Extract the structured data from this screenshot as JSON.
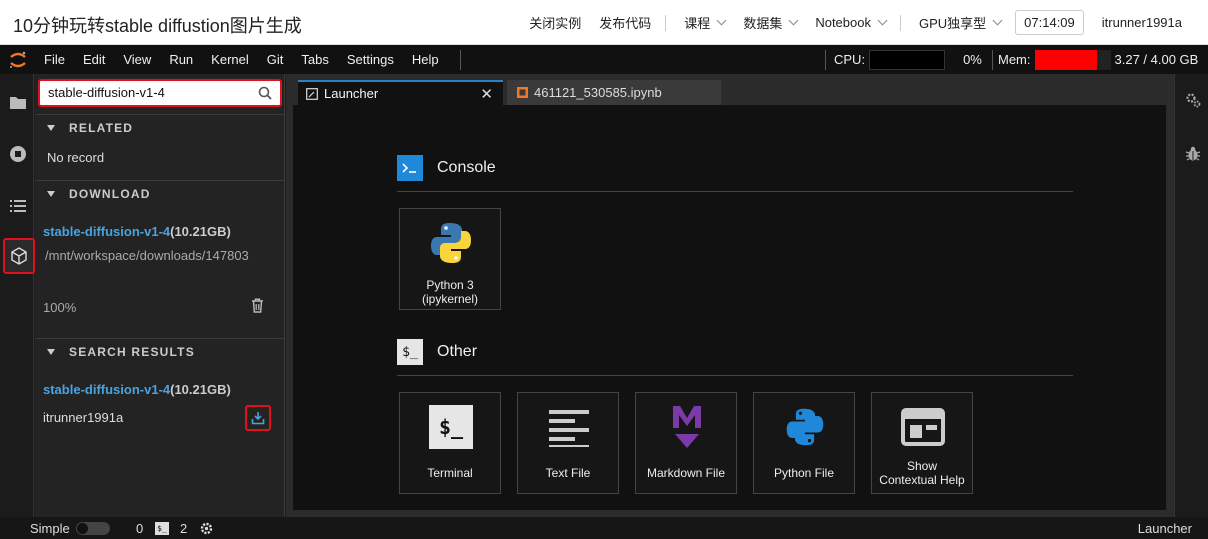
{
  "window_title": "10分钟玩转stable diffustion图片生成",
  "topnav": {
    "close_instance": "关闭实例",
    "publish_code": "发布代码",
    "course": "课程",
    "dataset": "数据集",
    "notebook": "Notebook",
    "gpu": "GPU独享型",
    "timer": "07:14:09",
    "user": "itrunner1991a"
  },
  "menubar": {
    "items": [
      "File",
      "Edit",
      "View",
      "Run",
      "Kernel",
      "Git",
      "Tabs",
      "Settings",
      "Help"
    ],
    "cpu_label": "CPU:",
    "cpu_value": "0%",
    "mem_label": "Mem:",
    "mem_value": "3.27 / 4.00 GB",
    "mem_fraction": 0.82,
    "mem_color": "#ff0000"
  },
  "sidebar": {
    "search_value": "stable-diffusion-v1-4",
    "related_header": "RELATED",
    "related_empty": "No record",
    "download_header": "DOWNLOAD",
    "download_item": {
      "name": "stable-diffusion-v1-4",
      "size": "(10.21GB)",
      "path": "/mnt/workspace/downloads/147803",
      "progress": "100%"
    },
    "results_header": "SEARCH RESULTS",
    "result_item": {
      "name": "stable-diffusion-v1-4",
      "size": "(10.21GB)",
      "owner": "itrunner1991a"
    }
  },
  "tabs": [
    {
      "label": "Launcher",
      "active": true
    },
    {
      "label": "461121_530585.ipynb",
      "active": false
    }
  ],
  "launcher": {
    "console_title": "Console",
    "console_cards": [
      {
        "label": "Python 3\n(ipykernel)",
        "icon": "python-icon"
      }
    ],
    "other_title": "Other",
    "other_cards": [
      {
        "label": "Terminal",
        "icon": "terminal-icon"
      },
      {
        "label": "Text File",
        "icon": "text-file-icon"
      },
      {
        "label": "Markdown File",
        "icon": "markdown-icon"
      },
      {
        "label": "Python File",
        "icon": "python-file-icon"
      },
      {
        "label": "Show\nContextual Help",
        "icon": "contextual-help-icon"
      }
    ]
  },
  "statusbar": {
    "mode": "Simple",
    "kernels": "0",
    "terminals": "2",
    "right": "Launcher"
  }
}
